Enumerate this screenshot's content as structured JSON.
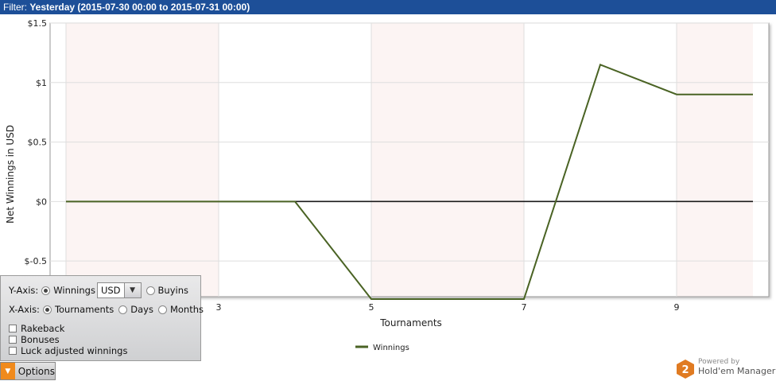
{
  "filter": {
    "label": "Filter:",
    "value": "Yesterday (2015-07-30 00:00 to 2015-07-31 00:00)"
  },
  "chart_data": {
    "type": "line",
    "xlabel": "Tournaments",
    "ylabel": "Net Winnings in USD",
    "xlim": [
      1,
      10
    ],
    "ylim": [
      -0.8,
      1.5
    ],
    "x_ticks": [
      {
        "value": 3,
        "label": "3"
      },
      {
        "value": 5,
        "label": "5"
      },
      {
        "value": 7,
        "label": "7"
      },
      {
        "value": 9,
        "label": "9"
      }
    ],
    "y_ticks": [
      {
        "value": 1.5,
        "label": "$1.5"
      },
      {
        "value": 1,
        "label": "$1"
      },
      {
        "value": 0.5,
        "label": "$0.5"
      },
      {
        "value": 0,
        "label": "$0"
      },
      {
        "value": -0.5,
        "label": "$-0.5"
      }
    ],
    "shaded_bands": [
      [
        1,
        3
      ],
      [
        5,
        7
      ],
      [
        9,
        10
      ]
    ],
    "grid": true,
    "legend_position": "bottom-center",
    "series": [
      {
        "name": "Winnings",
        "color": "#4a6324",
        "x": [
          1,
          2,
          3,
          4,
          5,
          6,
          7,
          8,
          9,
          10
        ],
        "y": [
          0,
          0,
          0,
          0,
          -0.82,
          -0.82,
          -0.82,
          1.15,
          0.9,
          0.9
        ]
      }
    ]
  },
  "options_panel": {
    "y_axis_label": "Y-Axis:",
    "winnings_label": "Winnings",
    "currency": "USD",
    "buyins_label": "Buyins",
    "x_axis_label": "X-Axis:",
    "tournaments_label": "Tournaments",
    "days_label": "Days",
    "months_label": "Months",
    "rakeback_label": "Rakeback",
    "bonuses_label": "Bonuses",
    "luck_label": "Luck adjusted winnings"
  },
  "options_button": {
    "label": "Options"
  },
  "brand": {
    "badge": "2",
    "powered": "Powered by",
    "name": "Hold'em Manager",
    "badge_color": "#e07b22"
  }
}
